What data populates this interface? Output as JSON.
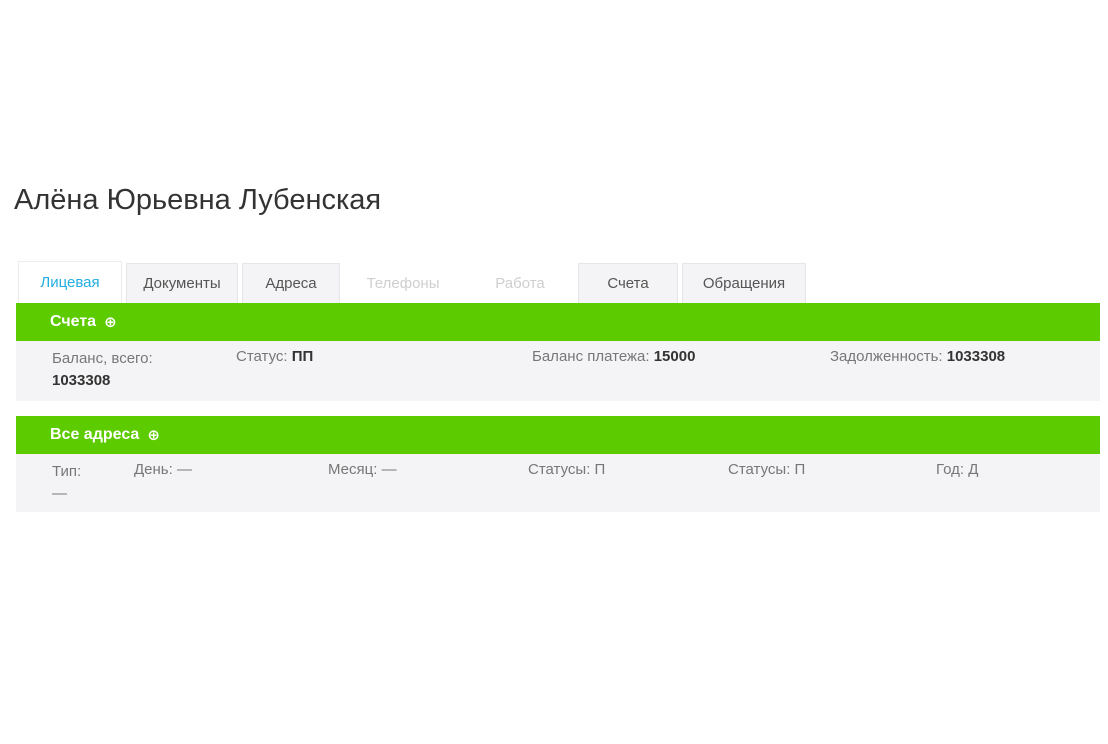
{
  "page": {
    "title": "Алёна Юрьевна Лубенская"
  },
  "tabs": [
    {
      "label": "Лицевая",
      "state": "active"
    },
    {
      "label": "Документы",
      "state": "normal"
    },
    {
      "label": "Адреса",
      "state": "normal"
    },
    {
      "label": "Телефоны",
      "state": "disabled"
    },
    {
      "label": "Работа",
      "state": "disabled"
    },
    {
      "label": "Счета",
      "state": "normal"
    },
    {
      "label": "Обращения",
      "state": "normal"
    }
  ],
  "accounts_section": {
    "title": "Счета",
    "add_icon": "plus-circle-icon",
    "fields": {
      "total_label": "Баланс, всего:",
      "total_value": "1033308",
      "overdue_label": "Статус:",
      "overdue_value": "ПП",
      "limit_label": "Баланс платежа:",
      "limit_value": "15000",
      "debt_label": "Задолженность:",
      "debt_value": "1033308"
    }
  },
  "address_section": {
    "title": "Все адреса",
    "add_icon": "plus-circle-icon",
    "fields": {
      "type_label": "Тип:",
      "type_value": "—",
      "day_label": "День:",
      "day_value": "—",
      "month_label": "Месяц:",
      "month_value": "—",
      "c1_label": "Статусы:",
      "c1_value": "П",
      "c2_label": "Статусы:",
      "c2_value": "П",
      "year_label": "Год:",
      "year_value": "Д"
    }
  },
  "colors": {
    "accent_green": "#5ccb00",
    "active_tab_text": "#22aee0",
    "panel_bg": "#f4f4f6"
  }
}
